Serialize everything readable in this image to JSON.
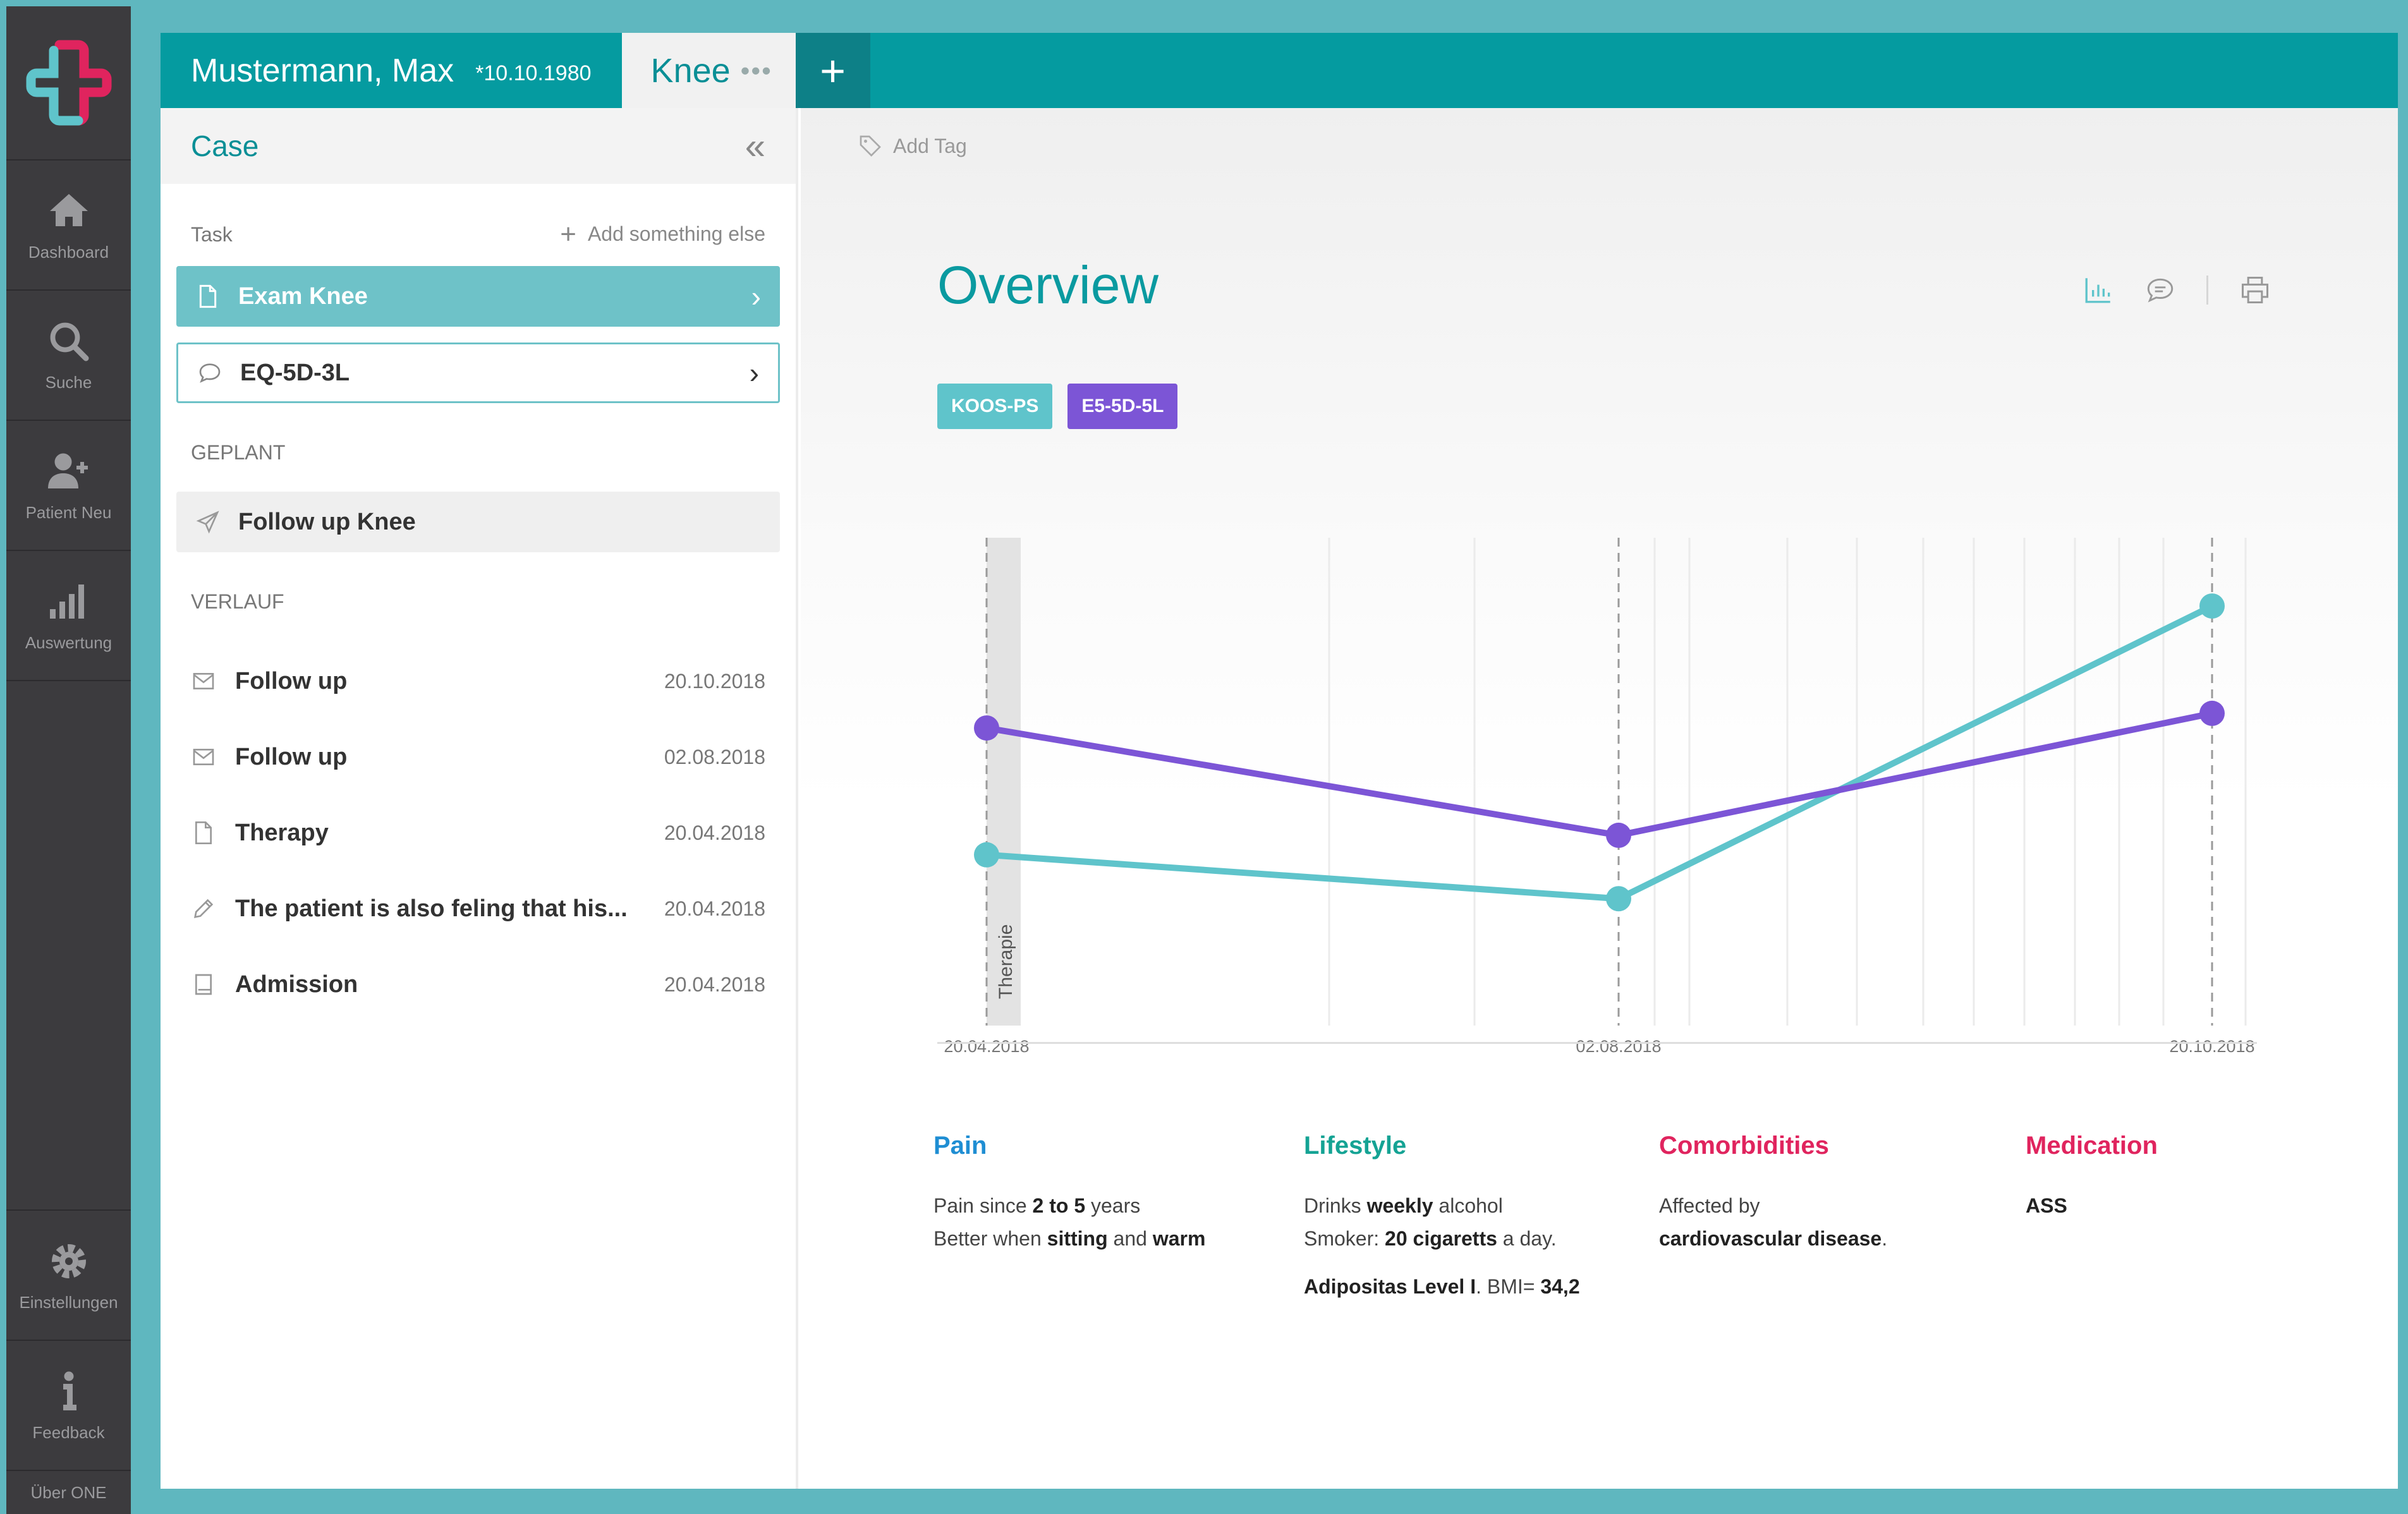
{
  "nav": {
    "items": [
      {
        "label": "Dashboard",
        "icon": "home-icon"
      },
      {
        "label": "Suche",
        "icon": "search-icon"
      },
      {
        "label": "Patient Neu",
        "icon": "add-user-icon"
      },
      {
        "label": "Auswertung",
        "icon": "bar-chart-icon"
      }
    ],
    "bottom": [
      {
        "label": "Einstellungen",
        "icon": "gear-icon"
      },
      {
        "label": "Feedback",
        "icon": "info-icon"
      }
    ],
    "about": "Über ONE"
  },
  "header": {
    "patient_name": "Mustermann, Max",
    "patient_dob": "*10.10.1980",
    "active_tab": "Knee",
    "tab_menu": "•••",
    "add_tab": "+"
  },
  "case": {
    "title": "Case",
    "collapse": "«",
    "task_label": "Task",
    "add_something": "Add something else",
    "tasks": [
      {
        "label": "Exam Knee",
        "icon": "document-icon"
      },
      {
        "label": "EQ-5D-3L",
        "icon": "chat-icon"
      }
    ],
    "planned_label": "GEPLANT",
    "planned": [
      {
        "label": "Follow up Knee",
        "icon": "send-icon"
      }
    ],
    "history_label": "VERLAUF",
    "history": [
      {
        "label": "Follow up",
        "date": "20.10.2018",
        "icon": "mail-icon"
      },
      {
        "label": "Follow up",
        "date": "02.08.2018",
        "icon": "mail-icon"
      },
      {
        "label": "Therapy",
        "date": "20.04.2018",
        "icon": "document-icon"
      },
      {
        "label": "The patient is also feling that his...",
        "date": "20.04.2018",
        "icon": "pencil-icon"
      },
      {
        "label": "Admission",
        "date": "20.04.2018",
        "icon": "book-icon"
      }
    ]
  },
  "content": {
    "add_tag": "Add Tag",
    "title": "Overview",
    "chips": [
      {
        "label": "KOOS-PS",
        "color": "#5fc4cb"
      },
      {
        "label": "E5-5D-5L",
        "color": "#7c55d6"
      }
    ]
  },
  "chart_data": {
    "type": "line",
    "x": [
      "20.04.2018",
      "02.08.2018",
      "20.10.2018"
    ],
    "series": [
      {
        "name": "KOOS-PS",
        "color": "#5fc4cb",
        "values": [
          35,
          26,
          86
        ]
      },
      {
        "name": "E5-5D-5L",
        "color": "#7c55d6",
        "values": [
          61,
          39,
          64
        ]
      }
    ],
    "ylim": [
      0,
      100
    ],
    "annotations": [
      {
        "x": "20.04.2018",
        "label": "Therapie"
      }
    ],
    "grid": true
  },
  "info": [
    {
      "heading": "Pain",
      "color": "#1f8ed3",
      "lines": [
        [
          {
            "t": "Pain since "
          },
          {
            "t": "2 to 5",
            "b": true
          },
          {
            "t": " years"
          }
        ],
        [
          {
            "t": "Better when "
          },
          {
            "t": "sitting",
            "b": true
          },
          {
            "t": " and "
          },
          {
            "t": "warm",
            "b": true
          }
        ]
      ]
    },
    {
      "heading": "Lifestyle",
      "color": "#14a394",
      "lines": [
        [
          {
            "t": "Drinks "
          },
          {
            "t": "weekly",
            "b": true
          },
          {
            "t": " alcohol"
          }
        ],
        [
          {
            "t": "Smoker: "
          },
          {
            "t": "20 cigaretts",
            "b": true
          },
          {
            "t": " a day."
          }
        ]
      ],
      "extra": [
        {
          "t": "Adipositas Level I",
          "b": true
        },
        {
          "t": ". BMI= "
        },
        {
          "t": "34,2",
          "b": true
        }
      ]
    },
    {
      "heading": "Comorbidities",
      "color": "#e0245e",
      "lines": [
        [
          {
            "t": "Affected by"
          }
        ],
        [
          {
            "t": "cardiovascular disease",
            "b": true
          },
          {
            "t": "."
          }
        ]
      ]
    },
    {
      "heading": "Medication",
      "color": "#e0245e",
      "lines": [
        [
          {
            "t": "ASS",
            "b": true
          }
        ]
      ]
    }
  ]
}
